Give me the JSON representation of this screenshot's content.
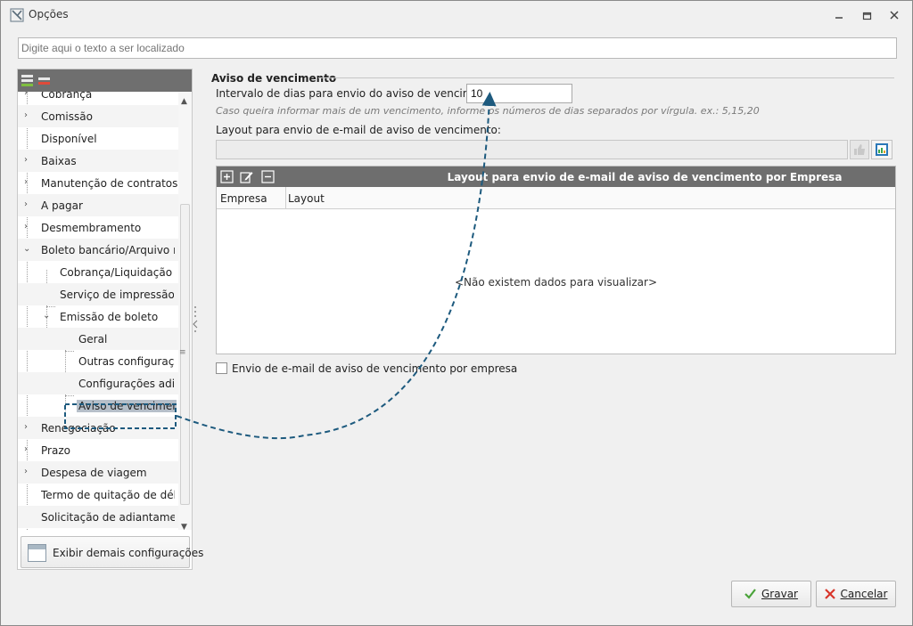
{
  "window": {
    "title": "Opções",
    "controls": [
      "minimize",
      "restore",
      "close"
    ]
  },
  "search": {
    "placeholder": "Digite aqui o texto a ser localizado"
  },
  "tree": {
    "items": [
      {
        "label": "Cobrança",
        "level": 0,
        "expander": "collapsed"
      },
      {
        "label": "Comissão",
        "level": 0,
        "expander": "collapsed"
      },
      {
        "label": "Disponível",
        "level": 0,
        "expander": "none"
      },
      {
        "label": "Baixas",
        "level": 0,
        "expander": "collapsed"
      },
      {
        "label": "Manutenção de contratos",
        "level": 0,
        "expander": "collapsed"
      },
      {
        "label": "A pagar",
        "level": 0,
        "expander": "collapsed"
      },
      {
        "label": "Desmembramento",
        "level": 0,
        "expander": "collapsed"
      },
      {
        "label": "Boleto bancário/Arquivo remessa",
        "level": 0,
        "expander": "expanded"
      },
      {
        "label": "Cobrança/Liquidação",
        "level": 1,
        "expander": "none"
      },
      {
        "label": "Serviço de impressão de boleto",
        "level": 1,
        "expander": "none"
      },
      {
        "label": "Emissão de boleto",
        "level": 1,
        "expander": "expanded"
      },
      {
        "label": "Geral",
        "level": 2,
        "expander": "none"
      },
      {
        "label": "Outras configurações",
        "level": 2,
        "expander": "none"
      },
      {
        "label": "Configurações adicionais",
        "level": 2,
        "expander": "none"
      },
      {
        "label": "Aviso de vencimento",
        "level": 2,
        "expander": "none",
        "selected": true
      },
      {
        "label": "Renegociação",
        "level": 0,
        "expander": "collapsed"
      },
      {
        "label": "Prazo",
        "level": 0,
        "expander": "collapsed"
      },
      {
        "label": "Despesa de viagem",
        "level": 0,
        "expander": "collapsed"
      },
      {
        "label": "Termo de quitação de débito",
        "level": 0,
        "expander": "none"
      },
      {
        "label": "Solicitação de adiantamento",
        "level": 0,
        "expander": "none"
      }
    ],
    "more_button": "Exibir demais configurações"
  },
  "content": {
    "section_title": "Aviso de vencimento",
    "interval_label": "Intervalo de dias para envio do aviso de vencimento:",
    "interval_value": "10",
    "interval_hint": "Caso queira informar mais de um vencimento, informe os números de dias separados por vírgula. ex.: 5,15,20",
    "layout_label": "Layout para envio de e-mail de aviso de vencimento:",
    "layout_value": "",
    "grid": {
      "title": "Layout para envio de e-mail de aviso de vencimento por Empresa",
      "columns": [
        "Empresa",
        "Layout"
      ],
      "empty_text": "<Não existem dados para visualizar>"
    },
    "checkbox_label": "Envio de e-mail de aviso de vencimento por empresa",
    "checkbox_checked": false
  },
  "buttons": {
    "save": "Gravar",
    "cancel": "Cancelar"
  },
  "colors": {
    "toolbar_dark": "#6e6e6e",
    "selection": "#b6bfc9",
    "annotation": "#1d5a7e",
    "save_icon": "#4aa33a",
    "cancel_icon": "#d8352a"
  }
}
